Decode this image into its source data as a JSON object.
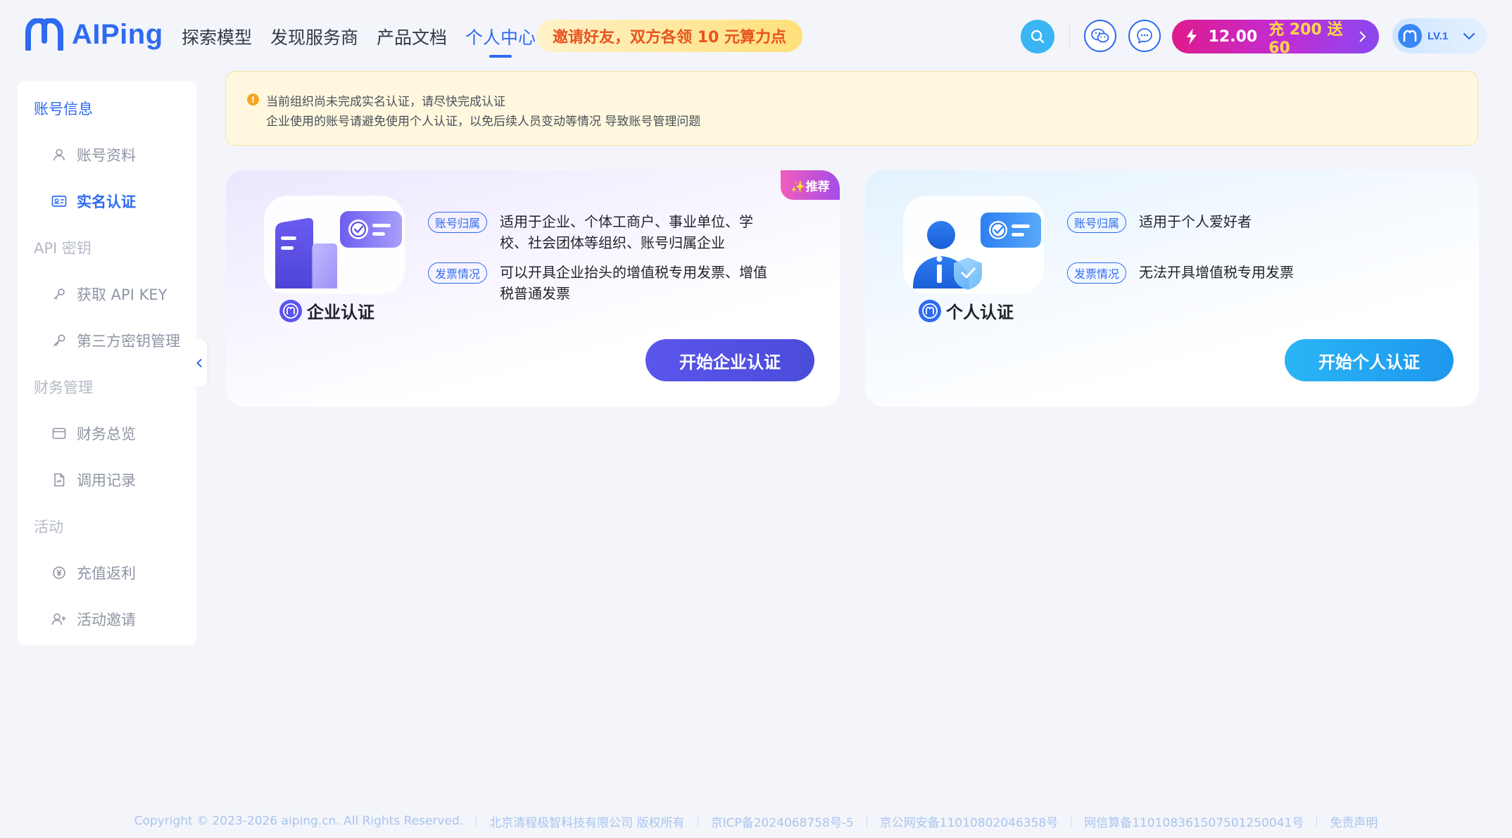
{
  "brand": {
    "logo_text": "AIPing"
  },
  "nav": {
    "items": [
      {
        "label": "探索模型"
      },
      {
        "label": "发现服务商"
      },
      {
        "label": "产品文档"
      },
      {
        "label": "个人中心"
      }
    ],
    "active_index": 3
  },
  "promo_banner": {
    "label": "邀请好友，双方各领 10 元算力点"
  },
  "header": {
    "icons": [
      "search-icon",
      "wechat-icon",
      "message-icon",
      "lightning-icon",
      "chevron-right-icon",
      "chevron-down-icon"
    ],
    "balance": {
      "amount": "12.00",
      "promo": "充 200 送 60"
    },
    "user": {
      "level": "LV.1"
    }
  },
  "sidebar": {
    "groups": [
      {
        "label": "账号信息",
        "active": true,
        "items": [
          {
            "label": "账号资料",
            "icon": "user-icon"
          },
          {
            "label": "实名认证",
            "icon": "id-card-icon",
            "active": true
          }
        ]
      },
      {
        "label": "API 密钥",
        "items": [
          {
            "label": "获取 API KEY",
            "icon": "link-key-icon"
          },
          {
            "label": "第三方密钥管理",
            "icon": "key-icon"
          }
        ]
      },
      {
        "label": "财务管理",
        "items": [
          {
            "label": "财务总览",
            "icon": "wallet-icon"
          },
          {
            "label": "调用记录",
            "icon": "document-icon"
          }
        ]
      },
      {
        "label": "活动",
        "items": [
          {
            "label": "充值返利",
            "icon": "yen-icon"
          },
          {
            "label": "活动邀请",
            "icon": "add-user-icon"
          }
        ]
      }
    ]
  },
  "notice": {
    "line1": "当前组织尚未完成实名认证，请尽快完成认证",
    "line2": "企业使用的账号请避免使用个人认证，以免后续人员变动等情况 导致账号管理问题"
  },
  "cards": {
    "enterprise": {
      "badge": "✨推荐",
      "title": "企业认证",
      "tag_account": "账号归属",
      "account_text": "适用于企业、个体工商户、事业单位、学校、社会团体等组织、账号归属企业",
      "tag_invoice": "发票情况",
      "invoice_text": "可以开具企业抬头的增值税专用发票、增值税普通发票",
      "button": "开始企业认证"
    },
    "personal": {
      "title": "个人认证",
      "tag_account": "账号归属",
      "account_text": "适用于个人爱好者",
      "tag_invoice": "发票情况",
      "invoice_text": "无法开具增值税专用发票",
      "button": "开始个人认证"
    }
  },
  "colors": {
    "accent": "#2f6bf0",
    "enterprise_button": "#4b4cd9",
    "personal_button": "#1e97ee",
    "warning": "#f5a623"
  },
  "footer": {
    "items": [
      "Copyright © 2023-2026 aiping.cn. All Rights Reserved.",
      "北京清程极智科技有限公司 版权所有",
      "京ICP备2024068758号-5",
      "京公网安备11010802046358号",
      "网信算备110108361507501250041号",
      "免责声明"
    ]
  }
}
